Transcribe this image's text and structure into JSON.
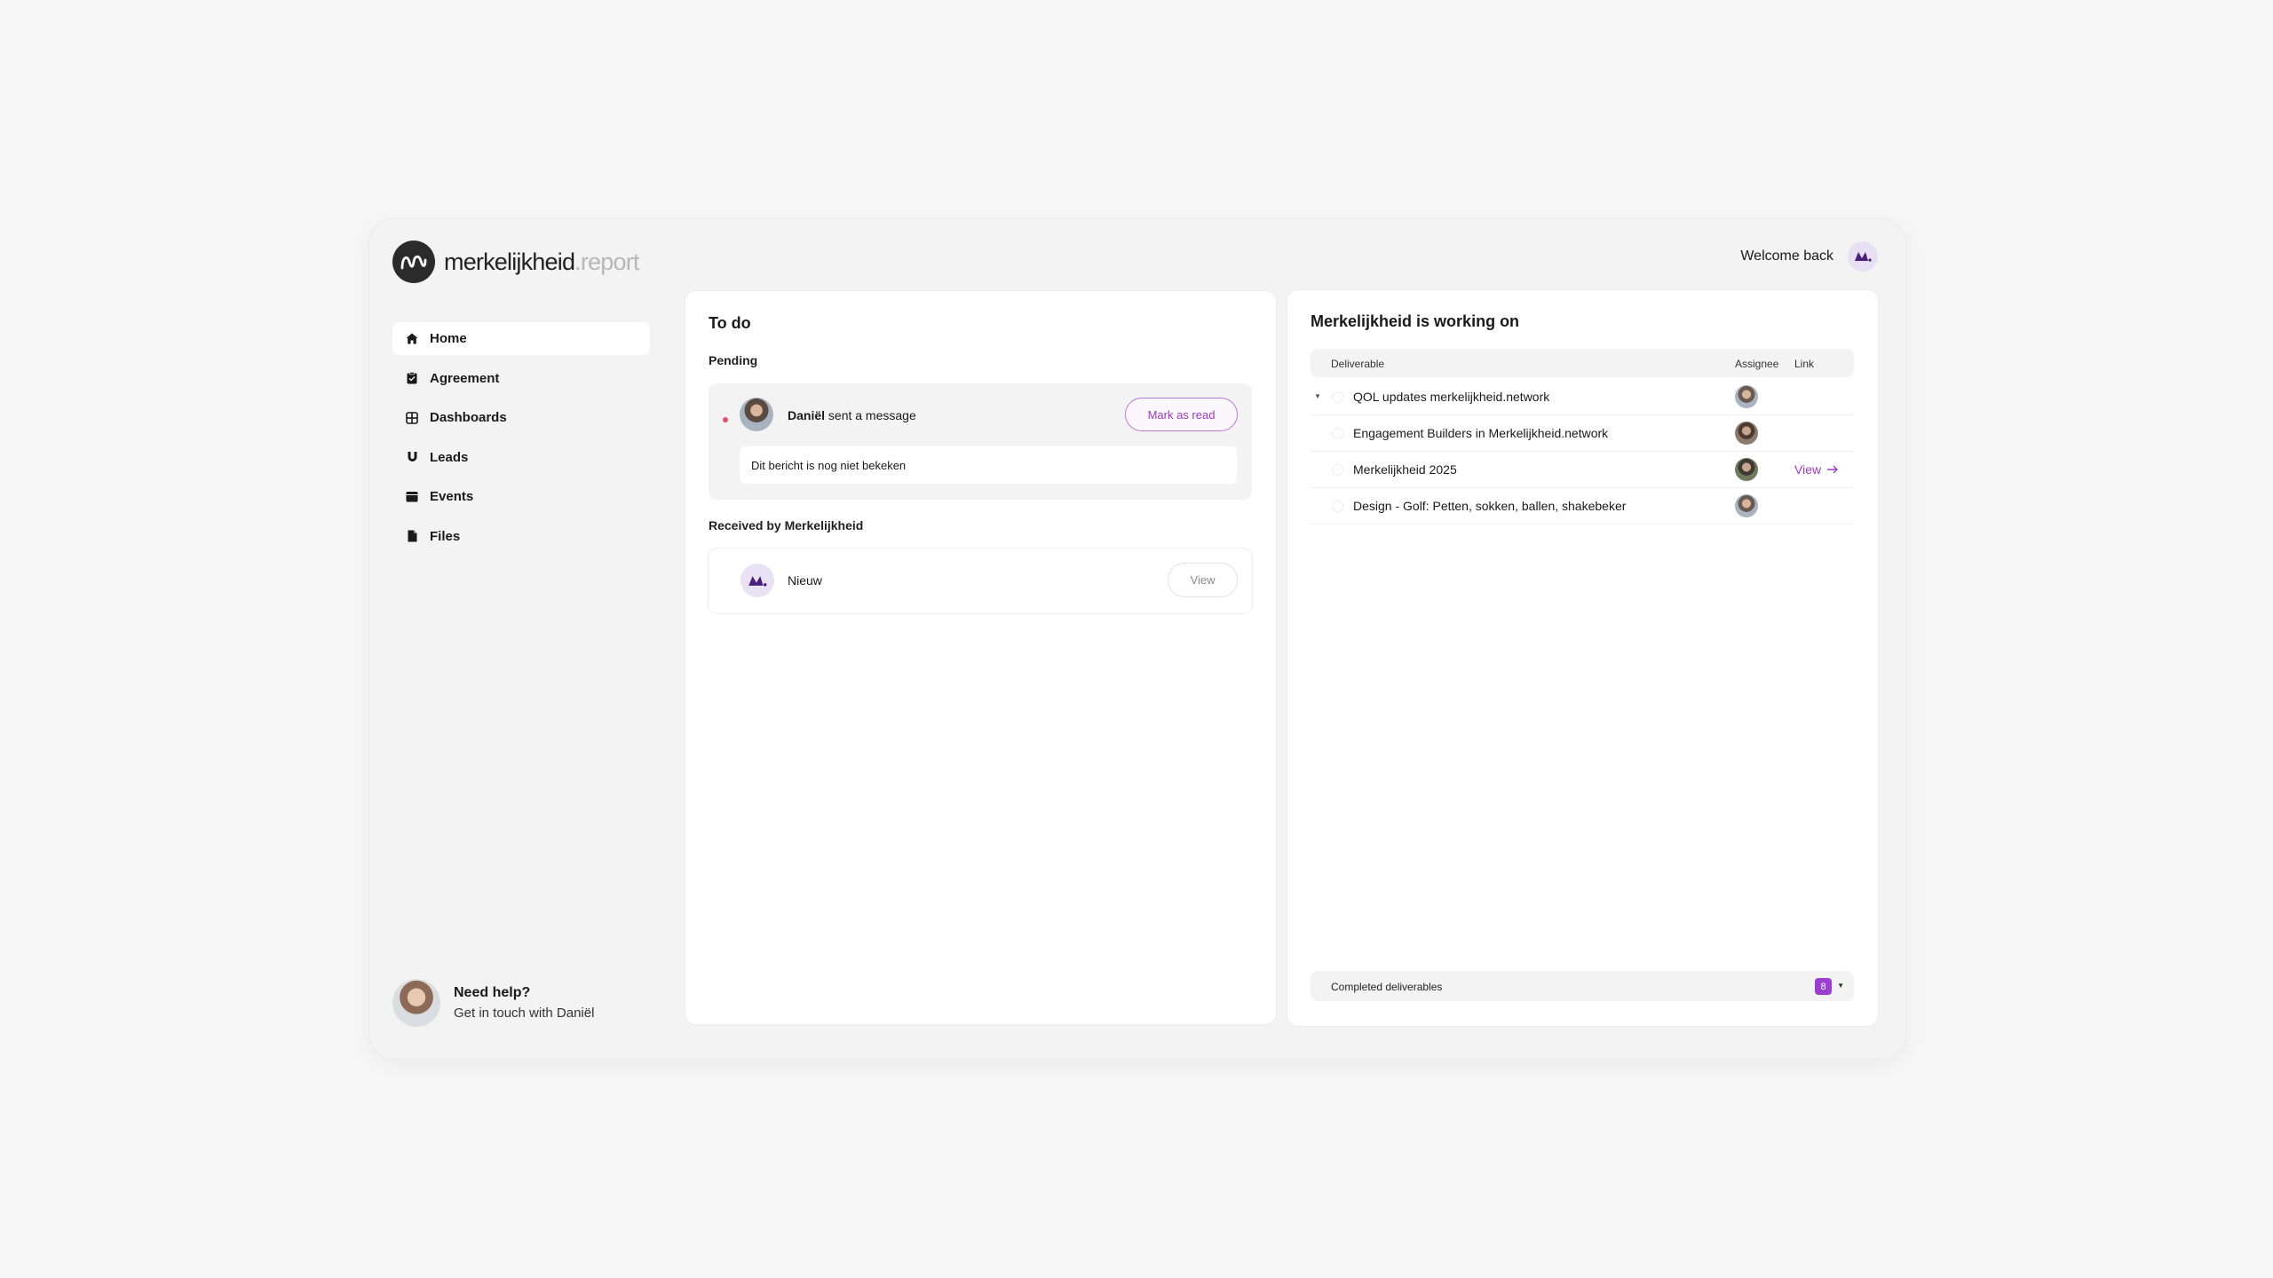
{
  "header": {
    "logo_name": "merkelijkheid",
    "logo_suffix": ".report",
    "welcome": "Welcome back"
  },
  "sidebar": {
    "items": [
      {
        "label": "Home",
        "icon": "home-icon",
        "active": true
      },
      {
        "label": "Agreement",
        "icon": "clipboard-icon"
      },
      {
        "label": "Dashboards",
        "icon": "grid-icon"
      },
      {
        "label": "Leads",
        "icon": "magnet-icon"
      },
      {
        "label": "Events",
        "icon": "calendar-icon"
      },
      {
        "label": "Files",
        "icon": "file-icon"
      }
    ],
    "help_title": "Need help?",
    "help_sub": "Get in touch with Daniël"
  },
  "todo": {
    "title": "To do",
    "pending_label": "Pending",
    "message": {
      "sender": "Daniël",
      "action": " sent a message",
      "button": "Mark as read",
      "body": "Dit bericht is nog niet bekeken"
    },
    "received_label": "Received by Merkelijkheid",
    "received": {
      "label": "Nieuw",
      "button": "View"
    }
  },
  "work": {
    "title": "Merkelijkheid is working on",
    "columns": {
      "deliverable": "Deliverable",
      "assignee": "Assignee",
      "link": "Link"
    },
    "rows": [
      {
        "label": "QOL updates merkelijkheid.network"
      },
      {
        "label": "Engagement Builders in Merkelijkheid.network"
      },
      {
        "label": "Merkelijkheid 2025",
        "link": "View"
      },
      {
        "label": "Design - Golf: Petten, sokken, ballen, shakebeker"
      }
    ],
    "completed_label": "Completed deliverables",
    "completed_count": "8"
  },
  "colors": {
    "accent": "#9b3cc0",
    "unread": "#e0526a",
    "badge": "#9a3fd0"
  }
}
